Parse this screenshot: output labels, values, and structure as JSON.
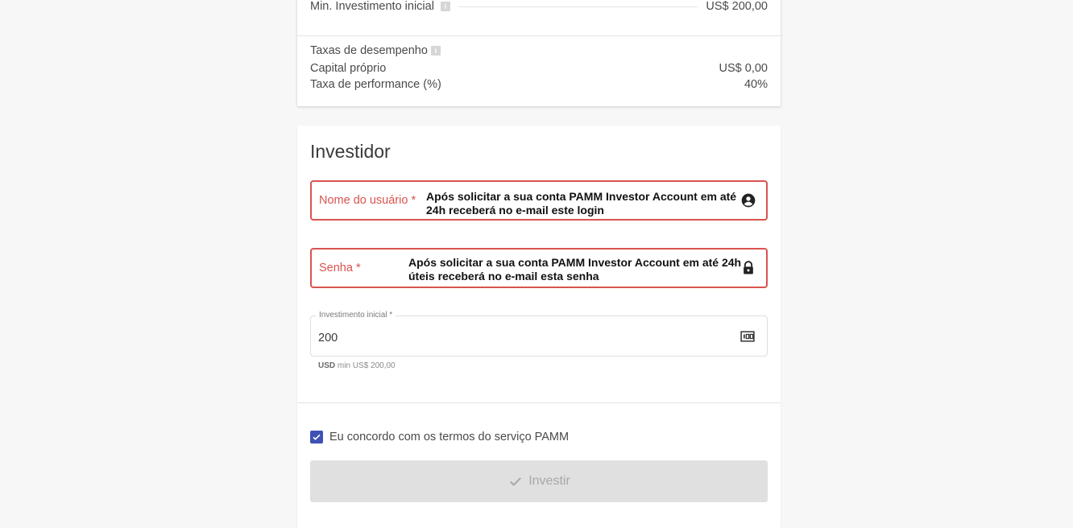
{
  "summary": {
    "min_investment_label": "Min. Investimento inicial",
    "min_investment_value": "US$ 200,00",
    "performance_fees_title": "Taxas de desempenho",
    "own_capital_label": "Capital próprio",
    "own_capital_value": "US$ 0,00",
    "performance_fee_label": "Taxa de performance (%)",
    "performance_fee_value": "40%"
  },
  "investor": {
    "title": "Investidor",
    "username": {
      "label": "Nome do usuário *",
      "value_line1": "Após solicitar a sua conta PAMM Investor Account em até",
      "value_line2": "24h receberá no e-mail este login"
    },
    "password": {
      "label": "Senha *",
      "value_line1": "Após solicitar a sua conta PAMM Investor Account em até 24h",
      "value_line2": "úteis receberá no e-mail esta senha"
    },
    "initial_investment": {
      "label": "Investimento inicial *",
      "value": "200",
      "helper_currency": "USD",
      "helper_text": "min US$ 200,00"
    },
    "terms_label": "Eu concordo com os termos do serviço PAMM",
    "terms_checked": true,
    "invest_button": "Investir"
  },
  "colors": {
    "error": "#d9534f",
    "checkbox": "#3f51b5",
    "button_disabled_bg": "#e0e0e0"
  },
  "icons": [
    "info-icon",
    "account-circle-icon",
    "lock-icon",
    "money-icon",
    "check-icon"
  ]
}
